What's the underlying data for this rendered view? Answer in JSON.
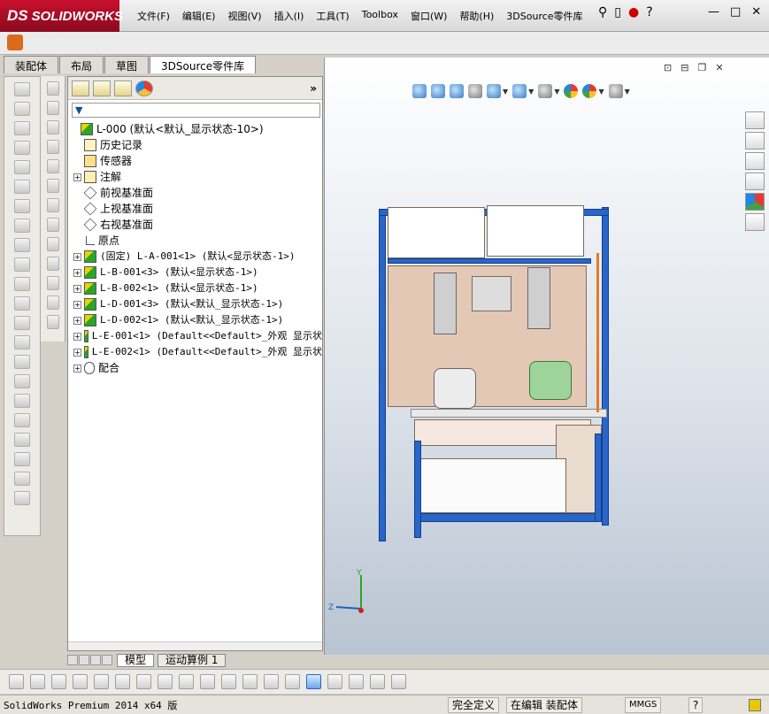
{
  "app": {
    "brand": "SOLIDWORKS",
    "brand_prefix": "DS",
    "menu": [
      "文件(F)",
      "编辑(E)",
      "视图(V)",
      "插入(I)",
      "工具(T)",
      "Toolbox",
      "窗口(W)",
      "帮助(H)",
      "3DSource零件库"
    ]
  },
  "command_tabs": [
    "装配体",
    "布局",
    "草图",
    "3DSource零件库"
  ],
  "active_tab_index": 3,
  "tree": {
    "expand_all": "»",
    "nodes": [
      {
        "label": "L-000  (默认<默认_显示状态-10>)",
        "icon": "assembly-icon",
        "indent": 0,
        "expander": ""
      },
      {
        "label": "历史记录",
        "icon": "history-icon",
        "indent": 1,
        "expander": ""
      },
      {
        "label": "传感器",
        "icon": "sensor-icon",
        "indent": 1,
        "expander": ""
      },
      {
        "label": "注解",
        "icon": "annotation-icon",
        "indent": 1,
        "expander": "+"
      },
      {
        "label": "前视基准面",
        "icon": "plane-icon",
        "indent": 1,
        "expander": ""
      },
      {
        "label": "上视基准面",
        "icon": "plane-icon",
        "indent": 1,
        "expander": ""
      },
      {
        "label": "右视基准面",
        "icon": "plane-icon",
        "indent": 1,
        "expander": ""
      },
      {
        "label": "原点",
        "icon": "origin-icon",
        "indent": 1,
        "expander": ""
      },
      {
        "label": "(固定) L-A-001<1> (默认<显示状态-1>)",
        "icon": "assembly-icon",
        "indent": 1,
        "expander": "+"
      },
      {
        "label": "L-B-001<3> (默认<显示状态-1>)",
        "icon": "assembly-icon",
        "indent": 1,
        "expander": "+"
      },
      {
        "label": "L-B-002<1> (默认<显示状态-1>)",
        "icon": "assembly-icon",
        "indent": 1,
        "expander": "+"
      },
      {
        "label": "L-D-001<3> (默认<默认_显示状态-1>)",
        "icon": "assembly-icon",
        "indent": 1,
        "expander": "+"
      },
      {
        "label": "L-D-002<1> (默认<默认_显示状态-1>)",
        "icon": "assembly-icon",
        "indent": 1,
        "expander": "+"
      },
      {
        "label": "L-E-001<1> (Default<<Default>_外观 显示状",
        "icon": "assembly-icon",
        "indent": 1,
        "expander": "+"
      },
      {
        "label": "L-E-002<1> (Default<<Default>_外观 显示状",
        "icon": "assembly-icon",
        "indent": 1,
        "expander": "+"
      },
      {
        "label": "配合",
        "icon": "mate-icon",
        "indent": 1,
        "expander": "+"
      }
    ]
  },
  "bottom_tabs": [
    "模型",
    "运动算例 1"
  ],
  "triad": {
    "y": "Y",
    "z": "Z"
  },
  "status": {
    "product": "SolidWorks Premium 2014 x64 版",
    "definition": "完全定义",
    "mode": "在编辑 装配体",
    "units": "MMGS",
    "help": "?"
  },
  "colors": {
    "frame": "#2a66c9",
    "accent": "#c8102e",
    "part": "#9ed49a"
  }
}
